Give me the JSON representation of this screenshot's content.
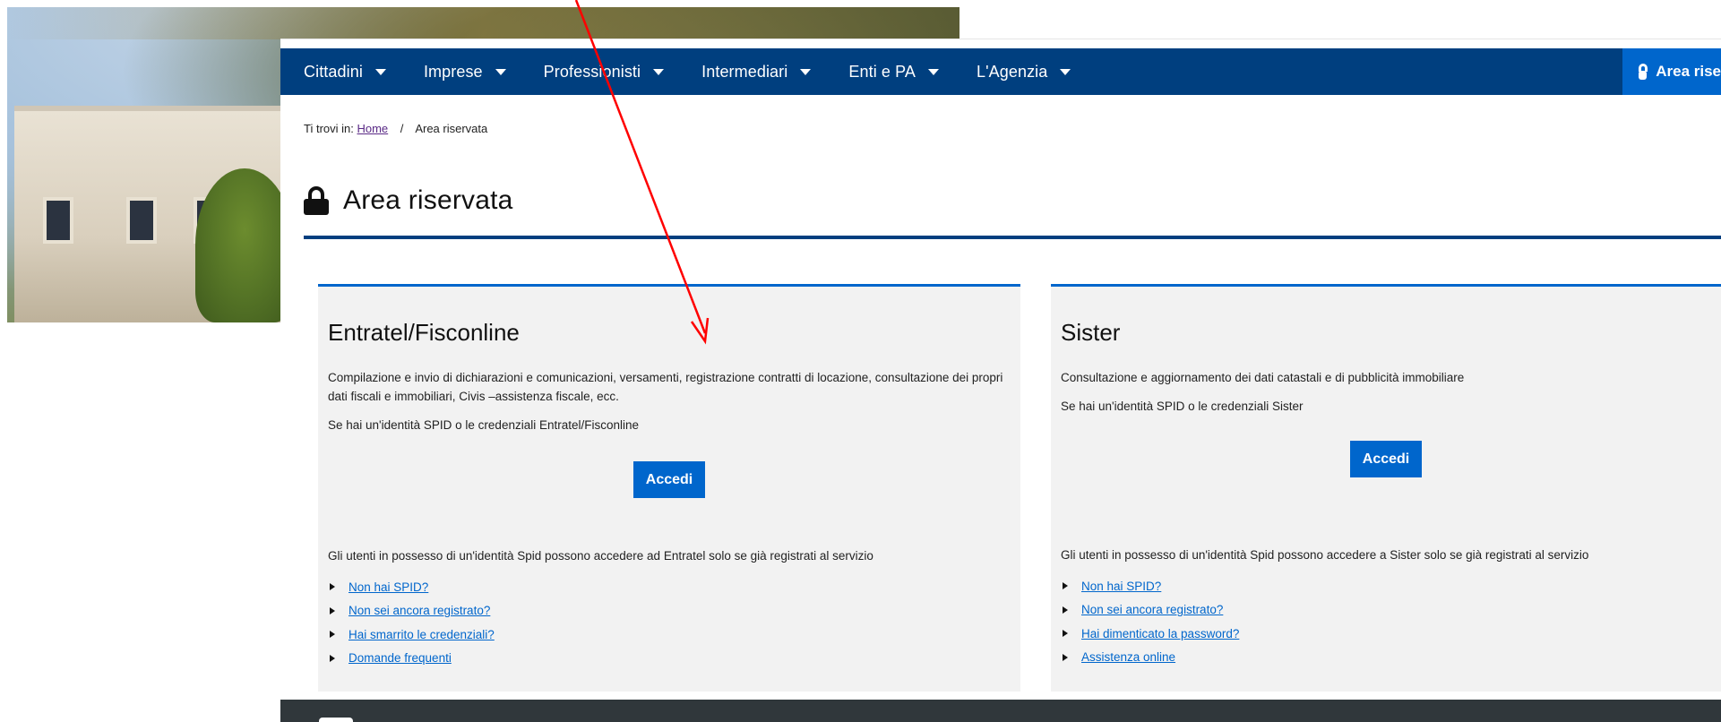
{
  "nav": {
    "items": [
      {
        "label": "Cittadini"
      },
      {
        "label": "Imprese"
      },
      {
        "label": "Professionisti"
      },
      {
        "label": "Intermediari"
      },
      {
        "label": "Enti e PA"
      },
      {
        "label": "L'Agenzia"
      }
    ],
    "reserved_label": "Area rise"
  },
  "breadcrumb": {
    "prefix": "Ti trovi in:",
    "home": "Home",
    "separator": "/",
    "current": "Area riservata"
  },
  "page_title": "Area riservata",
  "cards": {
    "left": {
      "title": "Entratel/Fisconline",
      "description": "Compilazione e invio di dichiarazioni e comunicazioni, versamenti, registrazione contratti di locazione, consultazione dei propri dati fiscali e immobiliari, Civis –assistenza fiscale, ecc.",
      "spid_text": "Se hai un'identità SPID o le credenziali Entratel/Fisconline",
      "button": "Accedi",
      "note": "Gli utenti in possesso di un'identità Spid possono accedere ad Entratel solo se già registrati al servizio",
      "links": [
        "Non hai SPID?",
        "Non sei ancora registrato?",
        "Hai smarrito le credenziali?",
        "Domande frequenti"
      ]
    },
    "right": {
      "title": "Sister",
      "description": "Consultazione e aggiornamento dei dati catastali e di pubblicità immobiliare",
      "spid_text": "Se hai un'identità SPID o le credenziali Sister",
      "button": "Accedi",
      "note": "Gli utenti in possesso di un'identità Spid possono accedere a Sister solo se già registrati al servizio",
      "links": [
        "Non hai SPID?",
        "Non sei ancora registrato?",
        "Hai dimenticato la password?",
        "Assistenza online"
      ]
    }
  },
  "colors": {
    "nav_bg": "#003f7f",
    "accent": "#0066cc",
    "card_bg": "#f2f2f2",
    "footer_bg": "#30373b",
    "annotation": "#ff0000"
  },
  "icons": {
    "lock": "lock-icon",
    "caret": "caret-down-icon",
    "bullet": "triangle-right-icon"
  }
}
